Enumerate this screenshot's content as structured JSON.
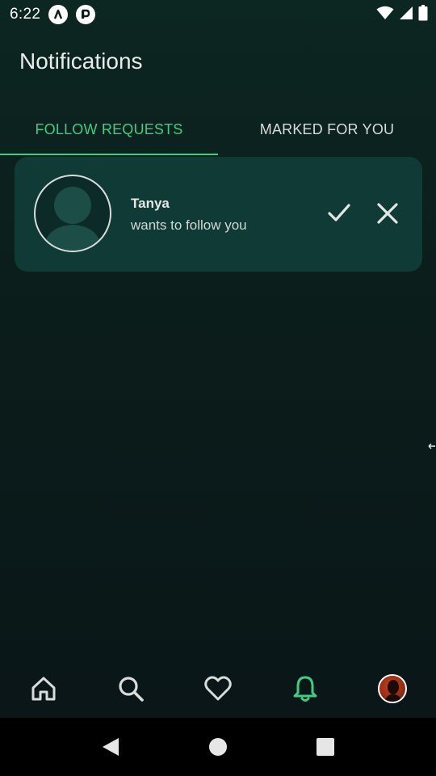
{
  "status_bar": {
    "time": "6:22",
    "icons": [
      "app-notification-a-icon",
      "app-notification-p-icon",
      "wifi-icon",
      "signal-icon",
      "battery-icon"
    ]
  },
  "header": {
    "title": "Notifications"
  },
  "tabs": [
    {
      "label": "FOLLOW REQUESTS",
      "active": true
    },
    {
      "label": "MARKED FOR YOU",
      "active": false
    }
  ],
  "requests": [
    {
      "name": "Tanya",
      "message": "wants to follow you",
      "actions": [
        "accept-icon",
        "decline-icon"
      ]
    }
  ],
  "bottom_nav": {
    "items": [
      "home-icon",
      "search-icon",
      "heart-icon",
      "bell-icon",
      "profile-avatar"
    ],
    "active": "bell-icon"
  },
  "system_nav": [
    "back-icon",
    "home-circle-icon",
    "recents-icon"
  ],
  "colors": {
    "accent": "#3ccf7f",
    "background_top": "#0c2621",
    "background_bottom": "#0a1517",
    "card": "#0f3a35"
  }
}
